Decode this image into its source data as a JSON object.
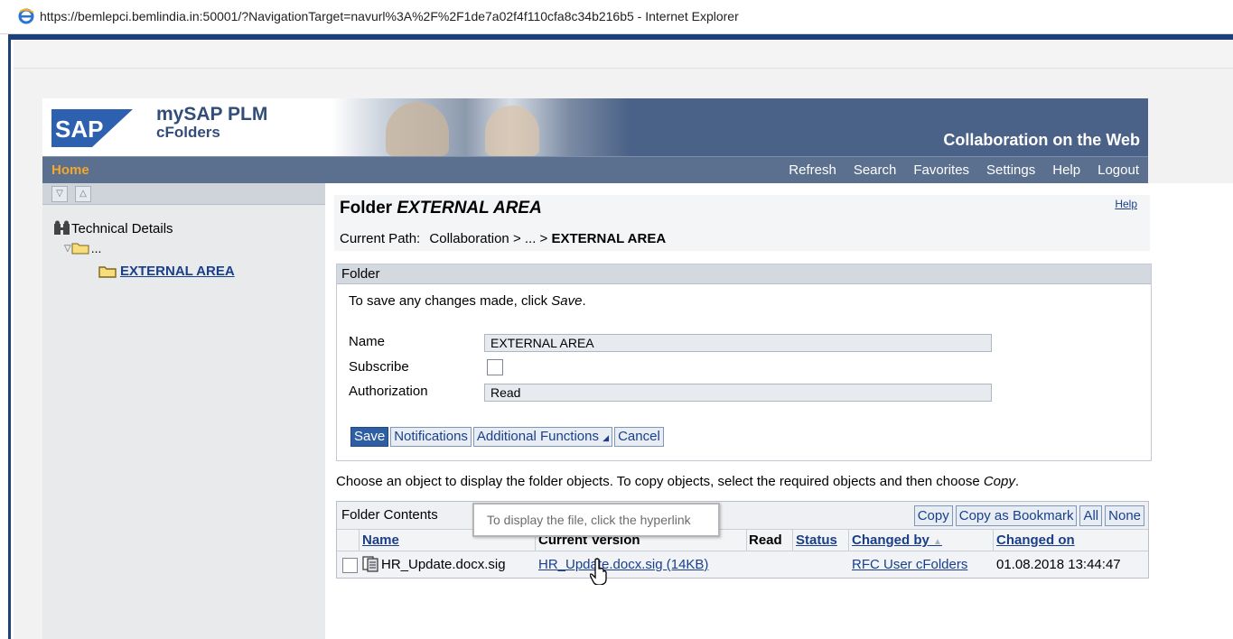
{
  "window": {
    "title": "https://bemlepci.bemlindia.in:50001/?NavigationTarget=navurl%3A%2F%2F1de7a02f4f110cfa8c34b216b5 - Internet Explorer"
  },
  "banner": {
    "logo_text": "SAP",
    "product_line1": "mySAP PLM",
    "product_line2": "cFolders",
    "tagline": "Collaboration on the Web"
  },
  "nav": {
    "home": "Home",
    "links": [
      "Refresh",
      "Search",
      "Favorites",
      "Settings",
      "Help",
      "Logout"
    ]
  },
  "tree": {
    "root": "Technical Details",
    "parent": "...",
    "current": "EXTERNAL AREA"
  },
  "header": {
    "title_prefix": "Folder",
    "title_name": "EXTERNAL AREA",
    "help": "Help",
    "path_label": "Current Path:",
    "path_middle": "Collaboration > ... >",
    "path_current": "EXTERNAL AREA"
  },
  "folder_form": {
    "section": "Folder",
    "hint_prefix": "To save any changes made, click",
    "hint_action": "Save",
    "hint_suffix": ".",
    "name_label": "Name",
    "name_value": "EXTERNAL AREA",
    "subscribe_label": "Subscribe",
    "authorization_label": "Authorization",
    "authorization_value": "Read",
    "buttons": {
      "save": "Save",
      "notifications": "Notifications",
      "additional": "Additional Functions",
      "cancel": "Cancel"
    }
  },
  "instructions": {
    "text": "Choose an object to display the folder objects. To copy objects, select the required objects and then choose",
    "action": "Copy",
    "suffix": "."
  },
  "contents": {
    "title": "Folder Contents",
    "buttons": {
      "copy": "Copy",
      "copy_bookmark": "Copy as Bookmark",
      "all": "All",
      "none": "None"
    },
    "columns": [
      "Name",
      "Current Version",
      "Read",
      "Status",
      "Changed by",
      "Changed on"
    ],
    "rows": [
      {
        "name": "HR_Update.docx.sig",
        "version": "HR_Update.docx.sig (14KB)",
        "read": "",
        "status": "",
        "changed_by": "RFC User cFolders",
        "changed_on": "01.08.2018 13:44:47"
      }
    ]
  },
  "tooltip": {
    "text": "To display the file, click the hyperlink"
  },
  "colors": {
    "banner": "#4a6287",
    "navbar": "#5b6f8e",
    "home": "#f3a82a",
    "link": "#1a3f8a",
    "primary_button": "#2f5ea3"
  }
}
